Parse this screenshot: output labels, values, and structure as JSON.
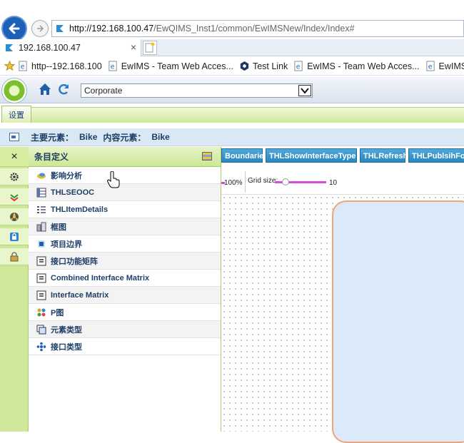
{
  "browser": {
    "url_host": "http://192.168.100.47",
    "url_path": "/EwQIMS_Inst1/common/EwIMSNew/Index/Index#",
    "tab_title": "192.168.100.47",
    "tab_close": "×",
    "favorites": [
      {
        "label": "http--192.168.100",
        "icon": "ie-page-icon"
      },
      {
        "label": "EwIMS - Team Web Acces...",
        "icon": "ie-page-icon"
      },
      {
        "label": "Test Link",
        "icon": "testlink-icon"
      },
      {
        "label": "EwIMS - Team Web Acces...",
        "icon": "ie-page-icon"
      },
      {
        "label": "EwIMS - Te",
        "icon": "ie-page-icon"
      }
    ]
  },
  "toolbar": {
    "scope_value": "Corporate"
  },
  "menu": {
    "tab_label": "设置"
  },
  "info": {
    "main_element_label": "主要元素：",
    "main_element_value": "Bike",
    "content_element_label": "内容元素：",
    "content_element_value": "Bike"
  },
  "left_panel": {
    "close_label": "×",
    "title": "条目定义",
    "items": [
      {
        "label": "影响分析",
        "icon": "impact-analysis-icon"
      },
      {
        "label": "THLSEOOC",
        "icon": "table-icon"
      },
      {
        "label": "THLItemDetails",
        "icon": "list-icon"
      },
      {
        "label": "框图",
        "icon": "block-diagram-icon"
      },
      {
        "label": "项目边界",
        "icon": "boundary-icon"
      },
      {
        "label": "接口功能矩阵",
        "icon": "matrix-icon"
      },
      {
        "label": "Combined Interface Matrix",
        "icon": "matrix-icon"
      },
      {
        "label": "Interface Matrix",
        "icon": "matrix-icon"
      },
      {
        "label": "P图",
        "icon": "p-diagram-icon"
      },
      {
        "label": "元素类型",
        "icon": "element-type-icon"
      },
      {
        "label": "接口类型",
        "icon": "interface-type-icon"
      }
    ]
  },
  "canvas": {
    "buttons": [
      "Boundaries",
      "THLShowInterfaceType",
      "THLRefresh",
      "THLPublsihForA"
    ],
    "zoom_label": "100%",
    "grid_label": "Grid size:",
    "grid_value": "10"
  },
  "colors": {
    "accent_green": "#cfe79a",
    "command_blue": "#2a86bd",
    "slider_magenta": "#d94bd9",
    "boundary_fill": "#dbe9f8",
    "boundary_stroke": "#f0a57a"
  }
}
